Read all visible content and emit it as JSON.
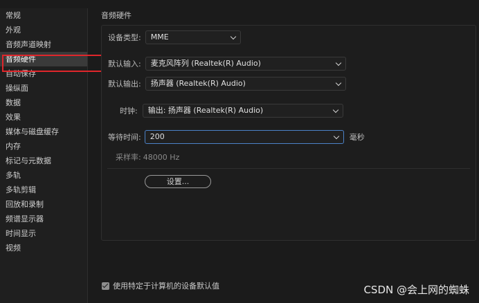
{
  "sidebar": {
    "items": [
      {
        "label": "常规"
      },
      {
        "label": "外观"
      },
      {
        "label": "音频声道映射"
      },
      {
        "label": "音频硬件"
      },
      {
        "label": "自动保存"
      },
      {
        "label": "操纵面"
      },
      {
        "label": "数据"
      },
      {
        "label": "效果"
      },
      {
        "label": "媒体与磁盘缓存"
      },
      {
        "label": "内存"
      },
      {
        "label": "标记与元数据"
      },
      {
        "label": "多轨"
      },
      {
        "label": "多轨剪辑"
      },
      {
        "label": "回放和录制"
      },
      {
        "label": "频谱显示器"
      },
      {
        "label": "时间显示"
      },
      {
        "label": "视频"
      }
    ],
    "selected_index": 3
  },
  "main": {
    "section_title": "音频硬件",
    "device_type": {
      "label": "设备类型:",
      "value": "MME"
    },
    "default_input": {
      "label": "默认输入:",
      "value": "麦克风阵列 (Realtek(R) Audio)"
    },
    "default_output": {
      "label": "默认输出:",
      "value": "扬声器 (Realtek(R) Audio)"
    },
    "clock": {
      "label": "时钟:",
      "value": "输出: 扬声器 (Realtek(R) Audio)"
    },
    "latency": {
      "label": "等待时间:",
      "value": "200",
      "unit": "毫秒"
    },
    "sample_rate": {
      "label": "采样率:",
      "value": "48000 Hz"
    },
    "settings_button": "设置...",
    "use_defaults_checkbox": {
      "label": "使用特定于计算机的设备默认值",
      "checked": true
    }
  },
  "watermark": "CSDN @会上网的蜘蛛",
  "colors": {
    "highlight_box": "#e0262b",
    "focus_border": "#4c82c8",
    "selected_item": "#3a3a3a"
  }
}
